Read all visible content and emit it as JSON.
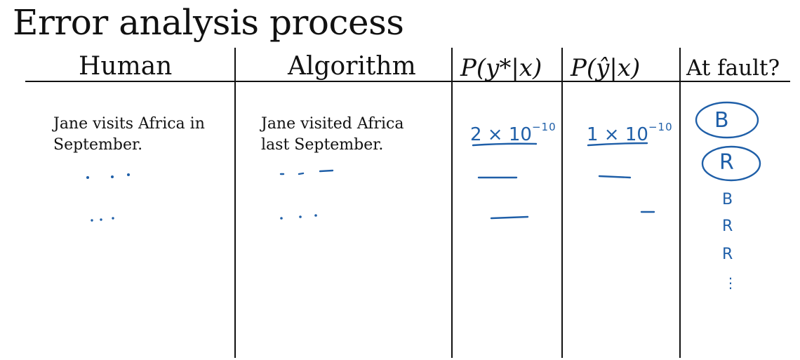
{
  "title": "Error analysis process",
  "columns": {
    "human": "Human",
    "algorithm": "Algorithm",
    "p_ystar": "P(y*|x)",
    "p_yhat": "P(ŷ|x)",
    "at_fault": "At fault?"
  },
  "rows": [
    {
      "human": "Jane visits Africa in\nSeptember.",
      "algorithm": "Jane visited Africa\nlast September.",
      "p_ystar_base": "2 × 10",
      "p_ystar_exp": "−10",
      "p_yhat_base": "1 × 10",
      "p_yhat_exp": "−10",
      "fault": "B"
    }
  ],
  "fault_column": [
    "B",
    "R",
    "B",
    "R",
    "R",
    "⋮"
  ],
  "colors": {
    "ink": "#1f5fa8",
    "text": "#111111",
    "background": "#ffffff"
  }
}
